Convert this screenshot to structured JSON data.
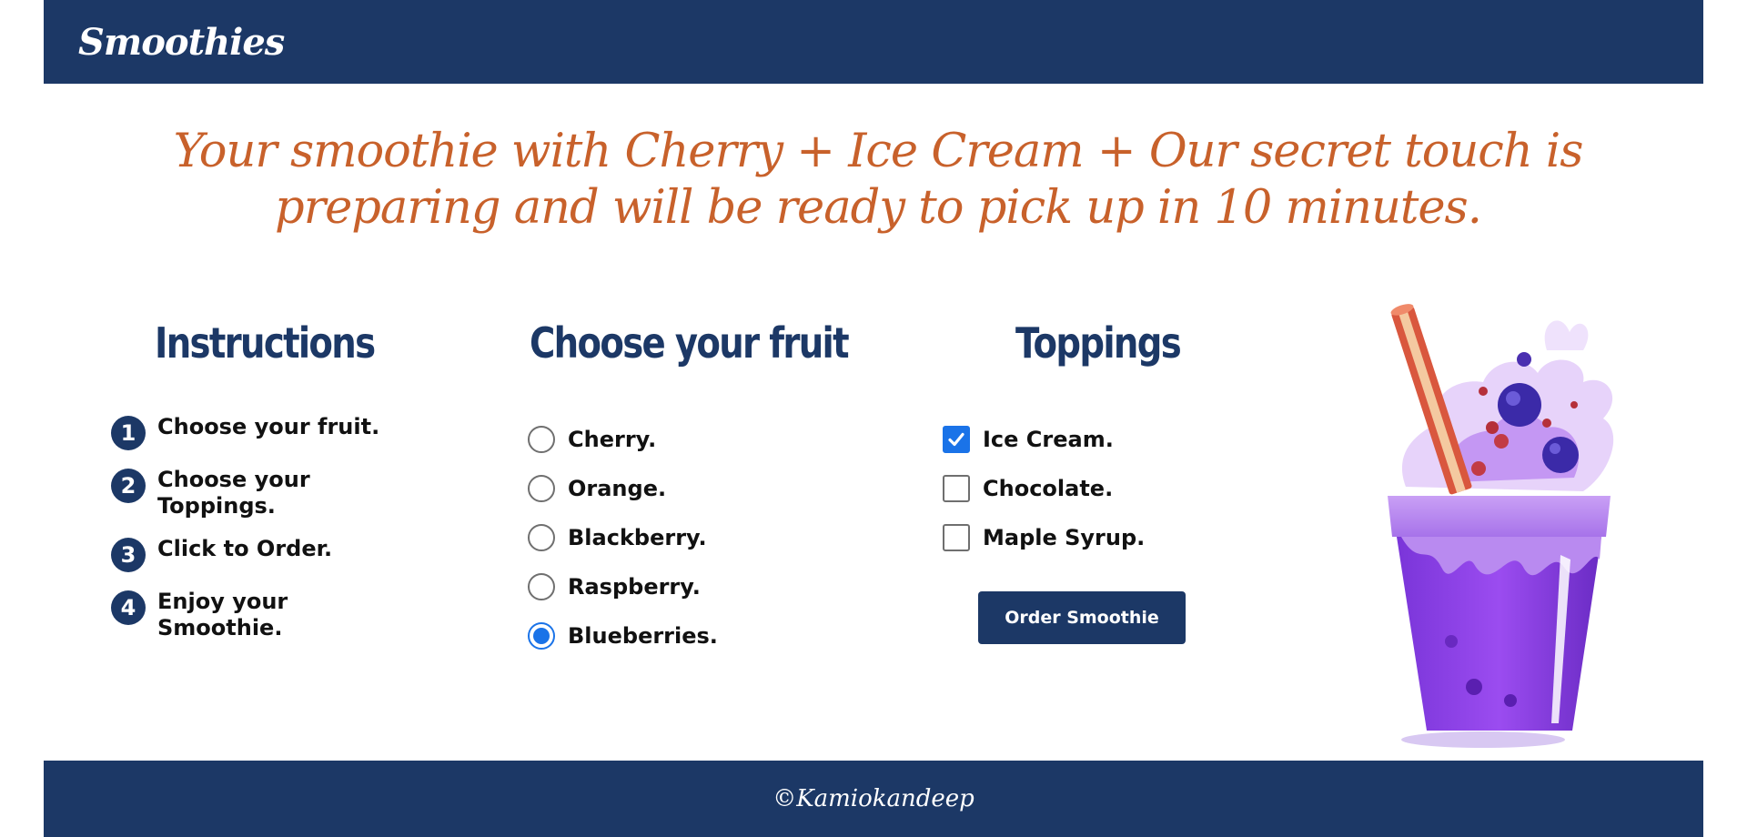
{
  "header": {
    "brand": "Smoothies"
  },
  "message": "Your smoothie with Cherry + Ice Cream + Our secret touch is preparing and will be ready to pick up in 10 minutes.",
  "instructions": {
    "heading": "Instructions",
    "steps": [
      {
        "num": "1",
        "text": "Choose your fruit."
      },
      {
        "num": "2",
        "text": "Choose your Toppings."
      },
      {
        "num": "3",
        "text": "Click to Order."
      },
      {
        "num": "4",
        "text": "Enjoy your Smoothie."
      }
    ]
  },
  "fruit": {
    "heading": "Choose your fruit",
    "options": [
      {
        "label": "Cherry.",
        "selected": false
      },
      {
        "label": "Orange.",
        "selected": false
      },
      {
        "label": "Blackberry.",
        "selected": false
      },
      {
        "label": "Raspberry.",
        "selected": false
      },
      {
        "label": "Blueberries.",
        "selected": true
      }
    ]
  },
  "toppings": {
    "heading": "Toppings",
    "options": [
      {
        "label": "Ice Cream.",
        "checked": true
      },
      {
        "label": "Chocolate.",
        "checked": false
      },
      {
        "label": "Maple Syrup.",
        "checked": false
      }
    ],
    "order_label": "Order Smoothie"
  },
  "footer": {
    "copyright": "©Kamiokandeep"
  },
  "colors": {
    "navy": "#1c3866",
    "message": "#c8612b",
    "accent": "#1a73e8"
  },
  "icons": {
    "checkmark": "checkmark-icon",
    "smoothie": "smoothie-cup-illustration"
  }
}
